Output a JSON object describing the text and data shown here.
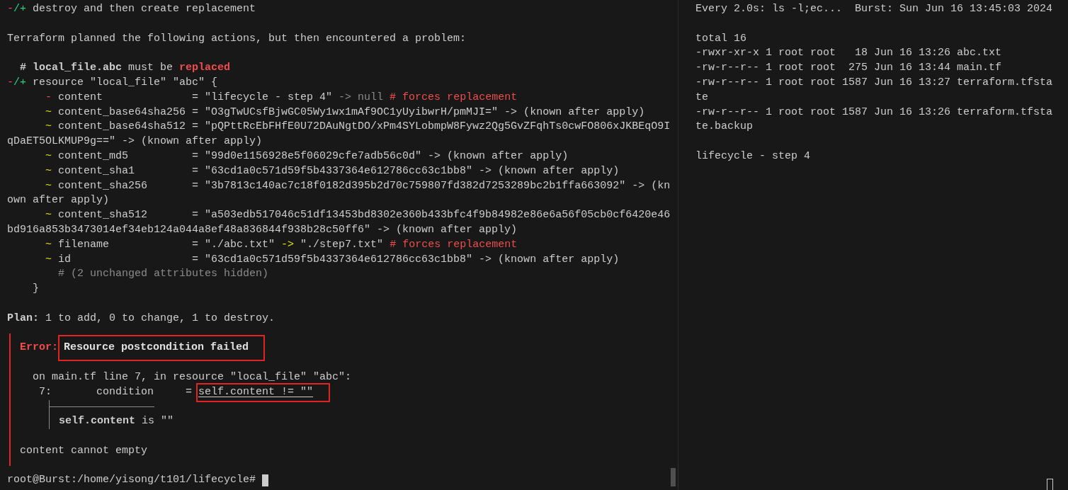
{
  "left_pane": {
    "lines": [
      {
        "kind": "text",
        "segments": [
          {
            "text": "-",
            "kind": "removed"
          },
          {
            "text": "/+",
            "kind": "added"
          },
          {
            "text": " destroy and then create replacement",
            "kind": "plain"
          }
        ]
      },
      {
        "kind": "blank"
      },
      {
        "kind": "text",
        "segments": [
          {
            "text": "Terraform planned the following actions, but then encountered a problem:",
            "kind": "plain"
          }
        ]
      },
      {
        "kind": "blank"
      },
      {
        "kind": "text",
        "segments": [
          {
            "text": "  **# local_file.abc** must be ",
            "kind": "plain"
          },
          {
            "text": "replaced",
            "kind": "alert"
          }
        ]
      },
      {
        "kind": "text",
        "segments": [
          {
            "text": "-",
            "kind": "removed"
          },
          {
            "text": "/+",
            "kind": "added"
          },
          {
            "text": " resource \"local_file\" \"abc\" {",
            "kind": "plain"
          }
        ]
      },
      {
        "kind": "text",
        "segments": [
          {
            "text": "      -",
            "kind": "removed"
          },
          {
            "text": " content              = \"lifecycle - step 4\" ",
            "kind": "plain"
          },
          {
            "text": "-> null",
            "kind": "muted"
          },
          {
            "text": " # forces replacement",
            "kind": "removed"
          }
        ]
      },
      {
        "kind": "text",
        "segments": [
          {
            "text": "      ~",
            "kind": "changed"
          },
          {
            "text": " content_base64sha256 = \"O3gTwUCsfBjwGC05Wy1wx1mAf9OC1yUyibwrH/pmMJI=\" -> (known after apply)",
            "kind": "plain"
          }
        ]
      },
      {
        "kind": "text",
        "segments": [
          {
            "text": "      ~",
            "kind": "changed"
          },
          {
            "text": " content_base64sha512 = \"pQPttRcEbFHfE0U72DAuNgtDO/xPm4SYLobmpW8Fywz2Qg5GvZFqhTs0cwFO806xJKBEqO9I",
            "kind": "plain"
          }
        ]
      },
      {
        "kind": "text",
        "segments": [
          {
            "text": "qDaET5OLKMUP9g==\" -> (known after apply)",
            "kind": "plain"
          }
        ]
      },
      {
        "kind": "text",
        "segments": [
          {
            "text": "      ~",
            "kind": "changed"
          },
          {
            "text": " content_md5          = \"99d0e1156928e5f06029cfe7adb56c0d\" -> (known after apply)",
            "kind": "plain"
          }
        ]
      },
      {
        "kind": "text",
        "segments": [
          {
            "text": "      ~",
            "kind": "changed"
          },
          {
            "text": " content_sha1         = \"63cd1a0c571d59f5b4337364e612786cc63c1bb8\" -> (known after apply)",
            "kind": "plain"
          }
        ]
      },
      {
        "kind": "text",
        "segments": [
          {
            "text": "      ~",
            "kind": "changed"
          },
          {
            "text": " content_sha256       = \"3b7813c140ac7c18f0182d395b2d70c759807fd382d7253289bc2b1ffa663092\" -> (kn",
            "kind": "plain"
          }
        ]
      },
      {
        "kind": "text",
        "segments": [
          {
            "text": "own after apply)",
            "kind": "plain"
          }
        ]
      },
      {
        "kind": "text",
        "segments": [
          {
            "text": "      ~",
            "kind": "changed"
          },
          {
            "text": " content_sha512       = \"a503edb517046c51df13453bd8302e360b433bfc4f9b84982e86e6a56f05cb0cf6420e46",
            "kind": "plain"
          }
        ]
      },
      {
        "kind": "text",
        "segments": [
          {
            "text": "bd916a853b3473014ef34eb124a044a8ef48a836844f938b28c50ff6\" -> (known after apply)",
            "kind": "plain"
          }
        ]
      },
      {
        "kind": "text",
        "segments": [
          {
            "text": "      ~",
            "kind": "changed"
          },
          {
            "text": " filename             = \"./abc.txt\" ",
            "kind": "plain"
          },
          {
            "text": "->",
            "kind": "changed"
          },
          {
            "text": " \"./step7.txt\"",
            "kind": "plain"
          },
          {
            "text": " # forces replacement",
            "kind": "removed"
          }
        ]
      },
      {
        "kind": "text",
        "segments": [
          {
            "text": "      ~",
            "kind": "changed"
          },
          {
            "text": " id                   = \"63cd1a0c571d59f5b4337364e612786cc63c1bb8\" -> (known after apply)",
            "kind": "plain"
          }
        ]
      },
      {
        "kind": "text",
        "segments": [
          {
            "text": "        # (2 unchanged attributes hidden)",
            "kind": "muted"
          }
        ]
      },
      {
        "kind": "text",
        "segments": [
          {
            "text": "    }",
            "kind": "plain"
          }
        ]
      },
      {
        "kind": "blank"
      },
      {
        "kind": "text",
        "segments": [
          {
            "text": "**Plan:** 1 to add, 0 to change, 1 to destroy.",
            "kind": "plain"
          }
        ]
      }
    ],
    "error": {
      "label": "Error:",
      "summary": "Resource postcondition failed",
      "location": "on main.tf line 7, in resource \"local_file\" \"abc\":",
      "source": {
        "line_number": "7:",
        "code": "condition     =",
        "expression": "self.content != \"\""
      },
      "detail": "**self.content** is \"\"",
      "message": "content cannot empty"
    },
    "prompt": "root@Burst:/home/yisong/t101/lifecycle#"
  },
  "right_pane": {
    "header": {
      "command": "Every 2.0s: ls -l;ec...",
      "host_time": "Burst: Sun Jun 16 13:45:03 2024"
    },
    "lines": [
      {
        "kind": "blank"
      },
      {
        "kind": "text",
        "text": "total 16"
      },
      {
        "kind": "text",
        "text": "-rwxr-xr-x 1 root root   18 Jun 16 13:26 abc.txt"
      },
      {
        "kind": "text",
        "text": "-rw-r--r-- 1 root root  275 Jun 16 13:44 main.tf"
      },
      {
        "kind": "text",
        "text": "-rw-r--r-- 1 root root 1587 Jun 16 13:27 terraform.tfsta"
      },
      {
        "kind": "text",
        "text": "te"
      },
      {
        "kind": "text",
        "text": "-rw-r--r-- 1 root root 1587 Jun 16 13:26 terraform.tfsta"
      },
      {
        "kind": "text",
        "text": "te.backup"
      },
      {
        "kind": "blank"
      },
      {
        "kind": "text",
        "text": "lifecycle - step 4"
      }
    ]
  }
}
